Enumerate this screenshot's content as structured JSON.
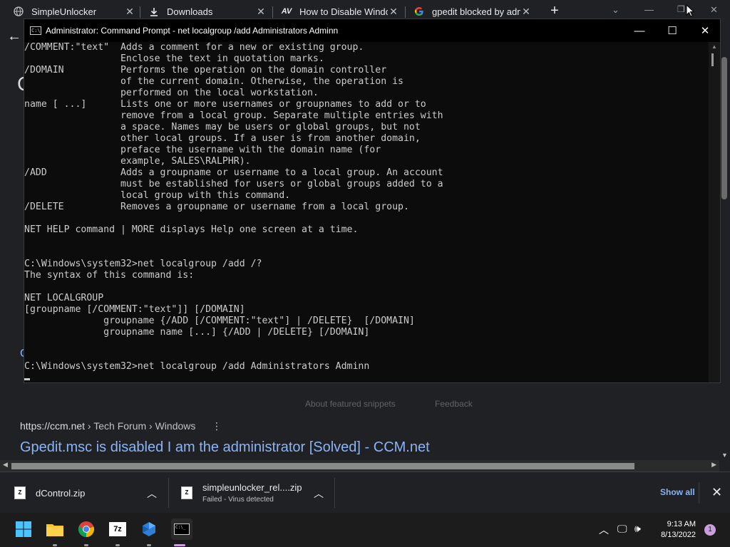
{
  "tabs": [
    {
      "title": "SimpleUnlocker",
      "icon": "globe-icon"
    },
    {
      "title": "Downloads",
      "icon": "download-icon"
    },
    {
      "title": "How to Disable Windo",
      "icon": "av-logo-icon"
    },
    {
      "title": "gpedit blocked by adm",
      "icon": "google-icon"
    }
  ],
  "cmd": {
    "title": "Administrator: Command Prompt - net  localgroup /add Administrators Adminn",
    "lines": [
      "/COMMENT:\"text\"  Adds a comment for a new or existing group.",
      "                 Enclose the text in quotation marks.",
      "/DOMAIN          Performs the operation on the domain controller",
      "                 of the current domain. Otherwise, the operation is",
      "                 performed on the local workstation.",
      "name [ ...]      Lists one or more usernames or groupnames to add or to",
      "                 remove from a local group. Separate multiple entries with",
      "                 a space. Names may be users or global groups, but not",
      "                 other local groups. If a user is from another domain,",
      "                 preface the username with the domain name (for",
      "                 example, SALES\\RALPHR).",
      "/ADD             Adds a groupname or username to a local group. An account",
      "                 must be established for users or global groups added to a",
      "                 local group with this command.",
      "/DELETE          Removes a groupname or username from a local group.",
      "",
      "NET HELP command | MORE displays Help one screen at a time.",
      "",
      "",
      "C:\\Windows\\system32>net localgroup /add /?",
      "The syntax of this command is:",
      "",
      "NET LOCALGROUP",
      "[groupname [/COMMENT:\"text\"]] [/DOMAIN]",
      "              groupname {/ADD [/COMMENT:\"text\"] | /DELETE}  [/DOMAIN]",
      "              groupname name [...] {/ADD | /DELETE} [/DOMAIN]",
      "",
      "",
      "C:\\Windows\\system32>net localgroup /add Administrators Adminn"
    ]
  },
  "page": {
    "result_url_domain": "https://ccm.net",
    "result_url_path": " › Tech Forum › Windows",
    "result_title": "Gpedit.msc is disabled I am the administrator [Solved] - CCM.net",
    "feedback_1": "About featured snippets",
    "feedback_2": "Feedback"
  },
  "downloads": [
    {
      "name": "dControl.zip",
      "status": ""
    },
    {
      "name": "simpleunlocker_rel....zip",
      "status": "Failed - Virus detected"
    }
  ],
  "downloads_show_all": "Show all",
  "taskbar": {
    "time": "9:13 AM",
    "date": "8/13/2022",
    "notification_count": "1",
    "apps": [
      "start-icon",
      "file-explorer-icon",
      "chrome-icon",
      "7zip-icon",
      "app-icon",
      "terminal-icon"
    ]
  },
  "colors": {
    "terminal_bg": "#0c0c0c",
    "terminal_fg": "#cccccc",
    "link": "#8ab4f8",
    "taskbar_active": "#c9a0dc"
  }
}
